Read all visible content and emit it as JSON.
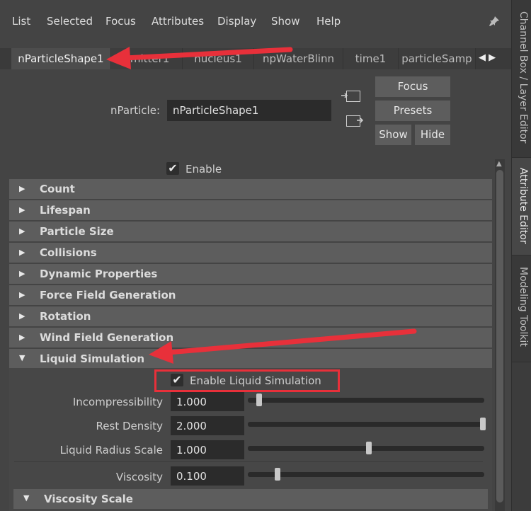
{
  "menu": {
    "items": [
      "List",
      "Selected",
      "Focus",
      "Attributes",
      "Display",
      "Show",
      "Help"
    ]
  },
  "tabs": [
    {
      "label": "nParticleShape1"
    },
    {
      "label": "emitter1"
    },
    {
      "label": "nucleus1"
    },
    {
      "label": "npWaterBlinn"
    },
    {
      "label": "time1"
    },
    {
      "label": "particleSamp"
    }
  ],
  "tab_arrows": "◀ ▶",
  "right_rail": {
    "tabs": [
      "Channel Box / Layer Editor",
      "Attribute Editor",
      "Modeling Toolkit"
    ]
  },
  "node": {
    "label": "nParticle:",
    "value": "nParticleShape1"
  },
  "buttons": {
    "focus": "Focus",
    "presets": "Presets",
    "show": "Show",
    "hide": "Hide"
  },
  "enable": {
    "label": "Enable",
    "checked": true
  },
  "sections": [
    {
      "title": "Count"
    },
    {
      "title": "Lifespan"
    },
    {
      "title": "Particle Size"
    },
    {
      "title": "Collisions"
    },
    {
      "title": "Dynamic Properties"
    },
    {
      "title": "Force Field Generation"
    },
    {
      "title": "Rotation"
    },
    {
      "title": "Wind Field Generation"
    },
    {
      "title": "Liquid Simulation"
    }
  ],
  "liquid": {
    "enable_label": "Enable Liquid Simulation",
    "enable_checked": true,
    "fields": [
      {
        "label": "Incompressibility",
        "value": "1.000",
        "slider": 0.02
      },
      {
        "label": "Rest Density",
        "value": "2.000",
        "slider": 1.0
      },
      {
        "label": "Liquid Radius Scale",
        "value": "1.000",
        "slider": 0.5
      },
      {
        "label": "Viscosity",
        "value": "0.100",
        "slider": 0.1
      }
    ],
    "sub_section": "Viscosity Scale"
  },
  "colors": {
    "annotation": "#e8303a"
  }
}
